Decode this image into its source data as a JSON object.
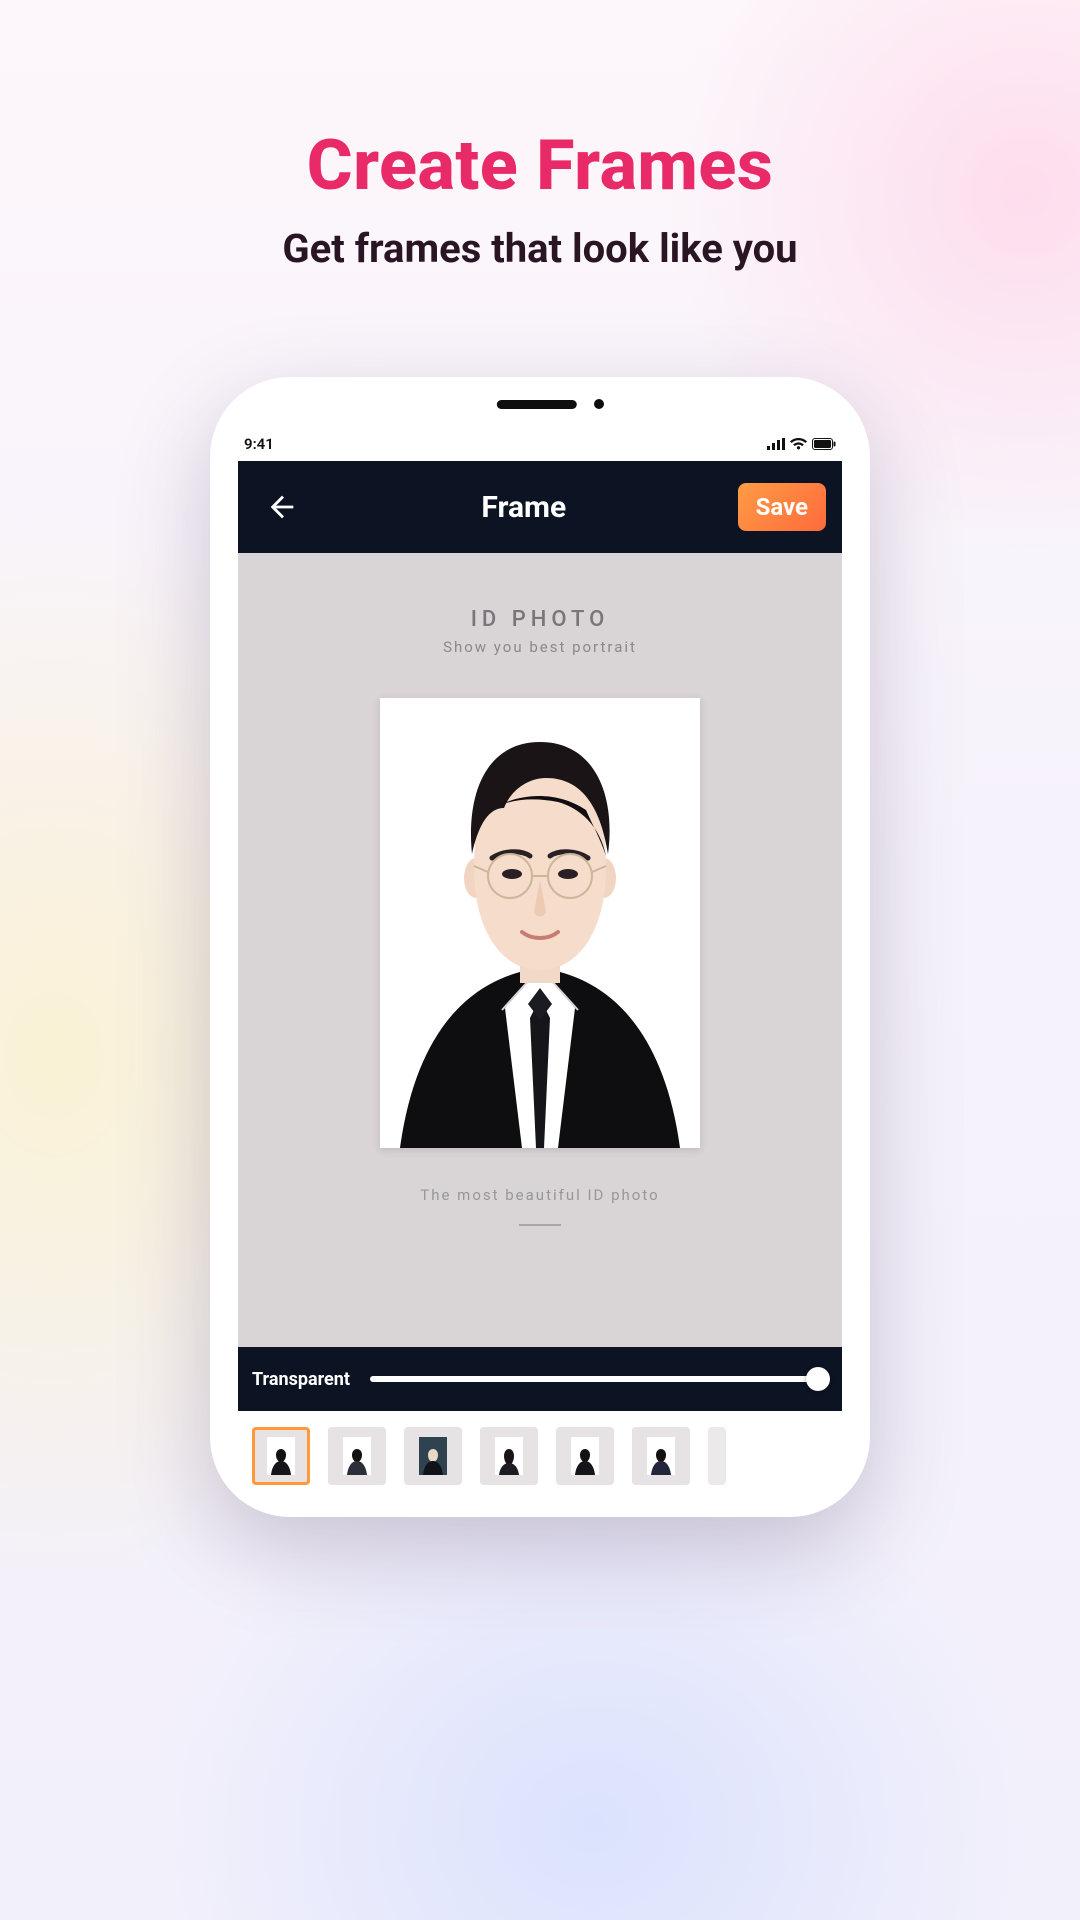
{
  "promo": {
    "title": "Create Frames",
    "subtitle": "Get frames that look like you"
  },
  "status": {
    "time": "9:41"
  },
  "nav": {
    "title": "Frame",
    "save_label": "Save"
  },
  "frame": {
    "heading": "ID PHOTO",
    "subheading": "Show you best portrait",
    "caption": "The most beautiful ID photo"
  },
  "slider": {
    "label": "Transparent",
    "value": 100
  },
  "thumbs": {
    "selected_index": 0,
    "count": 6
  },
  "colors": {
    "accent": "#e82a68",
    "save_button_start": "#ff9c43",
    "save_button_end": "#ff6a3d",
    "navbar_bg": "#0c1322",
    "thumb_selected_border": "#ff9a3a"
  }
}
